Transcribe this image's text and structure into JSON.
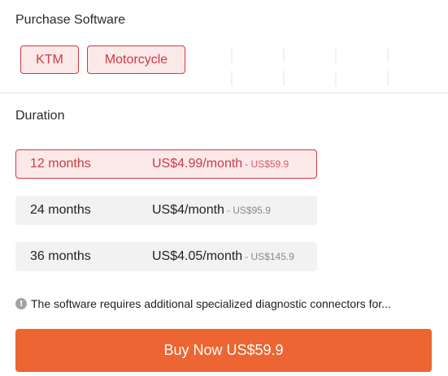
{
  "purchase": {
    "title": "Purchase Software",
    "options": [
      {
        "label": "KTM",
        "selected": true
      },
      {
        "label": "Motorcycle",
        "selected": true
      }
    ]
  },
  "duration": {
    "title": "Duration",
    "plans": [
      {
        "months": "12 months",
        "price": "US$4.99/month",
        "total": "- US$59.9",
        "selected": true
      },
      {
        "months": "24 months",
        "price": "US$4/month",
        "total": "- US$95.9",
        "selected": false
      },
      {
        "months": "36 months",
        "price": "US$4.05/month",
        "total": "- US$145.9",
        "selected": false
      }
    ]
  },
  "notice": {
    "icon": "info-icon",
    "text": "The software requires additional specialized diagnostic connectors for..."
  },
  "buy_button": {
    "label": "Buy Now US$59.9"
  },
  "colors": {
    "accent": "#cf3a42",
    "accent_bg": "#fbe9ea",
    "buy_button": "#ec6532"
  }
}
